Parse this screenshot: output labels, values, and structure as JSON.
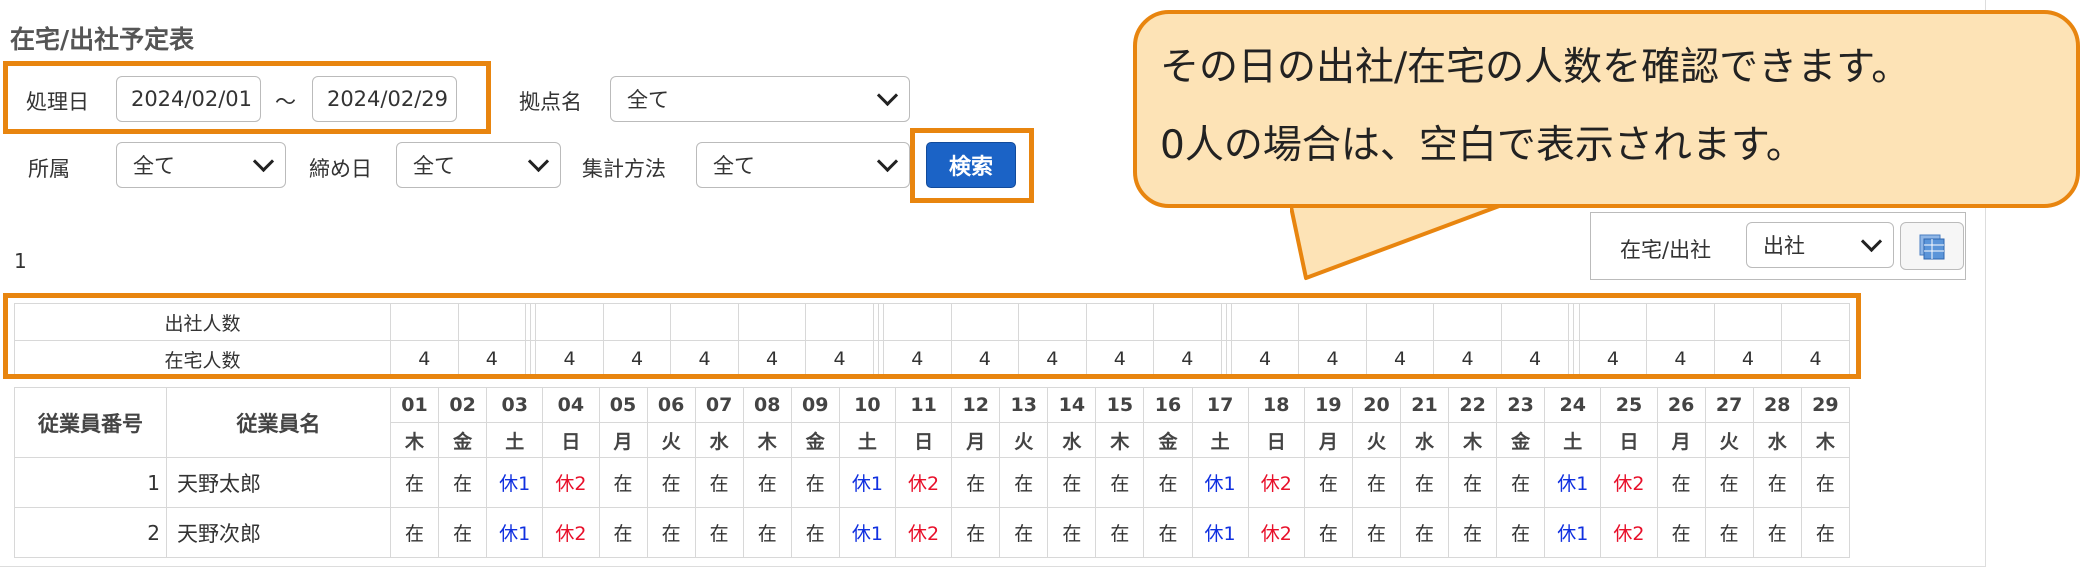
{
  "page": {
    "title": "在宅/出社予定表",
    "row_count": "1"
  },
  "filters": {
    "date_label": "処理日",
    "date_from": "2024/02/01",
    "date_sep": "～",
    "date_to": "2024/02/29",
    "site_label": "拠点名",
    "site_value": "全て",
    "dept_label": "所属",
    "dept_value": "全て",
    "closing_label": "締め日",
    "closing_value": "全て",
    "method_label": "集計方法",
    "method_value": "全て",
    "search_button": "検索"
  },
  "view_switch": {
    "label": "在宅/出社",
    "value": "出社",
    "export_icon": "spreadsheet-icon"
  },
  "callout": {
    "line1": "その日の出社/在宅の人数を確認できます。",
    "line2": "0人の場合は、空白で表示されます。"
  },
  "summary": {
    "office_label": "出社人数",
    "office_counts": [
      "",
      "",
      "",
      "",
      "",
      "",
      "",
      "",
      "",
      "",
      "",
      "",
      "",
      "",
      "",
      "",
      "",
      "",
      "",
      "",
      "",
      "",
      "",
      "",
      "",
      "",
      "",
      "",
      ""
    ],
    "home_label": "在宅人数",
    "home_counts": [
      "4",
      "4",
      "",
      "",
      "4",
      "4",
      "4",
      "4",
      "4",
      "",
      "",
      "4",
      "4",
      "4",
      "4",
      "4",
      "",
      "",
      "4",
      "4",
      "4",
      "4",
      "4",
      "",
      "",
      "4",
      "4",
      "4",
      "4"
    ]
  },
  "table": {
    "col_emp_no": "従業員番号",
    "col_emp_name": "従業員名",
    "days": [
      "01",
      "02",
      "03",
      "04",
      "05",
      "06",
      "07",
      "08",
      "09",
      "10",
      "11",
      "12",
      "13",
      "14",
      "15",
      "16",
      "17",
      "18",
      "19",
      "20",
      "21",
      "22",
      "23",
      "24",
      "25",
      "26",
      "27",
      "28",
      "29"
    ],
    "weekdays": [
      "木",
      "金",
      "土",
      "日",
      "月",
      "火",
      "水",
      "木",
      "金",
      "土",
      "日",
      "月",
      "火",
      "水",
      "木",
      "金",
      "土",
      "日",
      "月",
      "火",
      "水",
      "木",
      "金",
      "土",
      "日",
      "月",
      "火",
      "水",
      "木"
    ],
    "rows": [
      {
        "no": "1",
        "name": "天野太郎",
        "cells": [
          "在",
          "在",
          "休1",
          "休2",
          "在",
          "在",
          "在",
          "在",
          "在",
          "休1",
          "休2",
          "在",
          "在",
          "在",
          "在",
          "在",
          "休1",
          "休2",
          "在",
          "在",
          "在",
          "在",
          "在",
          "休1",
          "休2",
          "在",
          "在",
          "在",
          "在"
        ]
      },
      {
        "no": "2",
        "name": "天野次郎",
        "cells": [
          "在",
          "在",
          "休1",
          "休2",
          "在",
          "在",
          "在",
          "在",
          "在",
          "休1",
          "休2",
          "在",
          "在",
          "在",
          "在",
          "在",
          "休1",
          "休2",
          "在",
          "在",
          "在",
          "在",
          "在",
          "休1",
          "休2",
          "在",
          "在",
          "在",
          "在"
        ]
      }
    ]
  },
  "colors": {
    "highlight": "#e8850f",
    "callout_fill": "#fde3b6",
    "button": "#1b63c6",
    "leave1": "#1030e0",
    "leave2": "#e8102a"
  }
}
